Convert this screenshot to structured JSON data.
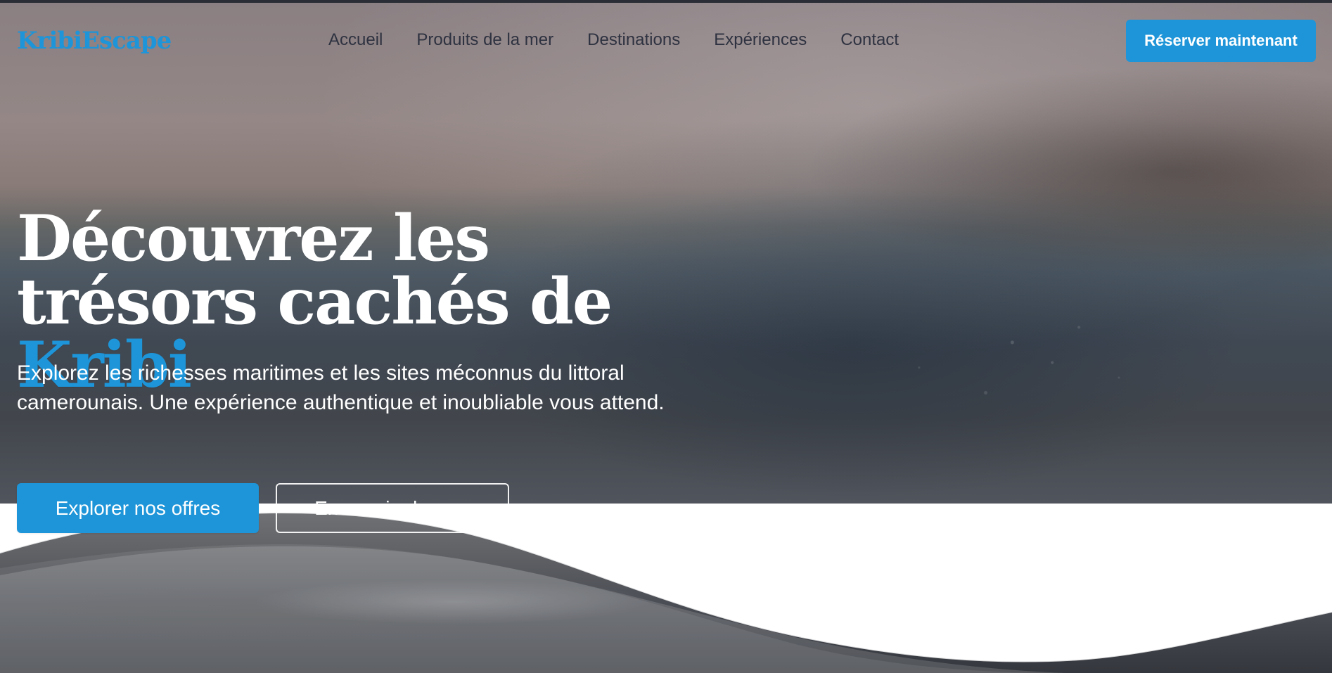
{
  "site": {
    "logo": "KribiEscape"
  },
  "nav": {
    "items": [
      {
        "label": "Accueil"
      },
      {
        "label": "Produits de la mer"
      },
      {
        "label": "Destinations"
      },
      {
        "label": "Expériences"
      },
      {
        "label": "Contact"
      }
    ],
    "cta_label": "Réserver maintenant"
  },
  "hero": {
    "title_part1": "Découvrez les trésors cachés de ",
    "title_accent": "Kribi",
    "subtitle": "Explorez les richesses maritimes et les sites méconnus du littoral camerounais. Une expérience authentique et inoubliable vous attend.",
    "primary_button": "Explorer nos offres",
    "secondary_button": "En savoir plus",
    "secondary_icon": "arrow-right-icon"
  },
  "colors": {
    "accent": "#1d95d8",
    "nav_text": "#2e3240",
    "white": "#ffffff"
  }
}
